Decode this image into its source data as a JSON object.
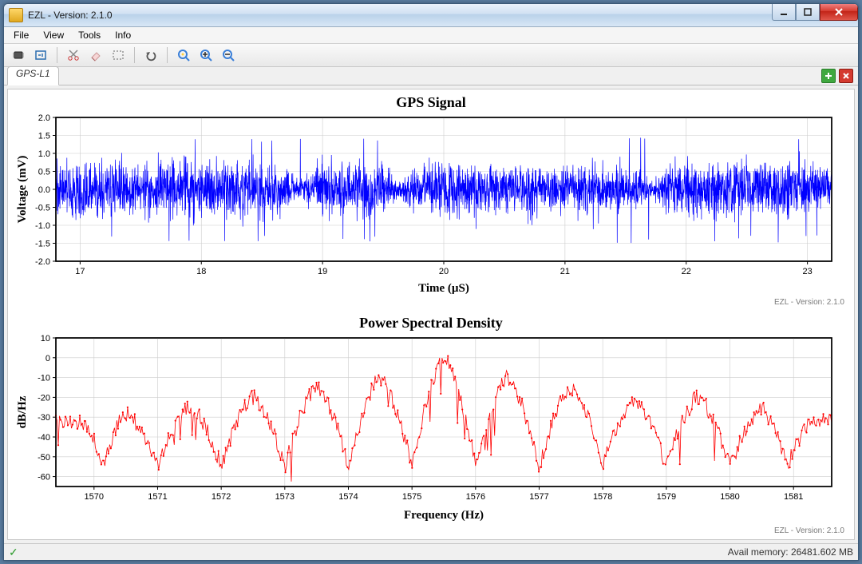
{
  "window": {
    "title": "EZL - Version: 2.1.0"
  },
  "menubar": {
    "items": [
      "File",
      "View",
      "Tools",
      "Info"
    ]
  },
  "toolbar": {
    "icons": [
      "chip-icon",
      "io-icon",
      "|",
      "scissors-icon",
      "eraser-icon",
      "marquee-icon",
      "|",
      "undo-icon",
      "|",
      "zoom-fit-icon",
      "zoom-in-icon",
      "zoom-out-icon"
    ]
  },
  "tabs": {
    "items": [
      {
        "label": "GPS-L1",
        "active": true
      }
    ]
  },
  "charts": {
    "signal": {
      "title": "GPS Signal",
      "watermark": "EZL - Version: 2.1.0",
      "xlabel": "Time (µS)",
      "ylabel": "Voltage (mV)"
    },
    "psd": {
      "title": "Power Spectral Density",
      "watermark": "EZL - Version: 2.1.0",
      "xlabel": "Frequency (Hz)",
      "ylabel": "dB/Hz"
    }
  },
  "statusbar": {
    "memory_label": "Avail memory:",
    "memory_value": "26481.602 MB"
  },
  "chart_data": [
    {
      "type": "line",
      "title": "GPS Signal",
      "xlabel": "Time (µS)",
      "ylabel": "Voltage (mV)",
      "xlim": [
        16.8,
        23.2
      ],
      "ylim": [
        -2.0,
        2.0
      ],
      "yticks": [
        -2.0,
        -1.5,
        -1.0,
        -0.5,
        0.0,
        0.5,
        1.0,
        1.5,
        2.0
      ],
      "xticks": [
        17,
        18,
        19,
        20,
        21,
        22,
        23
      ],
      "grid": true,
      "note": "dense noisy oscillation roughly ±1.0 mV with amplitude dips (phase transitions) near t≈18.8, 19.6, 21.7 µS; occasional peaks reach ±1.5 mV",
      "envelope": [
        {
          "t": 16.8,
          "amp": 1.05
        },
        {
          "t": 18.6,
          "amp": 1.05
        },
        {
          "t": 18.82,
          "amp": 0.35
        },
        {
          "t": 19.0,
          "amp": 1.1
        },
        {
          "t": 19.45,
          "amp": 1.1
        },
        {
          "t": 19.62,
          "amp": 0.3
        },
        {
          "t": 19.8,
          "amp": 1.05
        },
        {
          "t": 21.5,
          "amp": 1.05
        },
        {
          "t": 21.72,
          "amp": 0.3
        },
        {
          "t": 21.9,
          "amp": 1.05
        },
        {
          "t": 23.2,
          "amp": 1.05
        }
      ],
      "peak_amp": 1.5,
      "color": "#0000ff"
    },
    {
      "type": "line",
      "title": "Power Spectral Density",
      "xlabel": "Frequency (Hz)",
      "ylabel": "dB/Hz",
      "xlim": [
        1569.4,
        1581.6
      ],
      "ylim": [
        -65,
        10
      ],
      "yticks": [
        -60,
        -50,
        -40,
        -30,
        -20,
        -10,
        0,
        10
      ],
      "xticks": [
        1570,
        1571,
        1572,
        1573,
        1574,
        1575,
        1576,
        1577,
        1578,
        1579,
        1580,
        1581
      ],
      "grid": true,
      "note": "sinc-like lobed spectrum centered ~1575.5 Hz; main lobe peak ≈ 0 dB/Hz; side-lobe peaks descend symmetrically; deep nulls between lobes down to ≈ -55 to -60 dB/Hz",
      "lobes": [
        {
          "center": 1569.8,
          "peak": -32
        },
        {
          "center": 1570.5,
          "peak": -28
        },
        {
          "center": 1571.5,
          "peak": -24
        },
        {
          "center": 1572.5,
          "peak": -20
        },
        {
          "center": 1573.5,
          "peak": -15
        },
        {
          "center": 1574.5,
          "peak": -10
        },
        {
          "center": 1575.5,
          "peak": 0
        },
        {
          "center": 1576.5,
          "peak": -10
        },
        {
          "center": 1577.5,
          "peak": -15
        },
        {
          "center": 1578.5,
          "peak": -21
        },
        {
          "center": 1579.5,
          "peak": -20
        },
        {
          "center": 1580.5,
          "peak": -26
        },
        {
          "center": 1581.3,
          "peak": -32
        }
      ],
      "null_depth": -55,
      "color": "#ff0000"
    }
  ]
}
